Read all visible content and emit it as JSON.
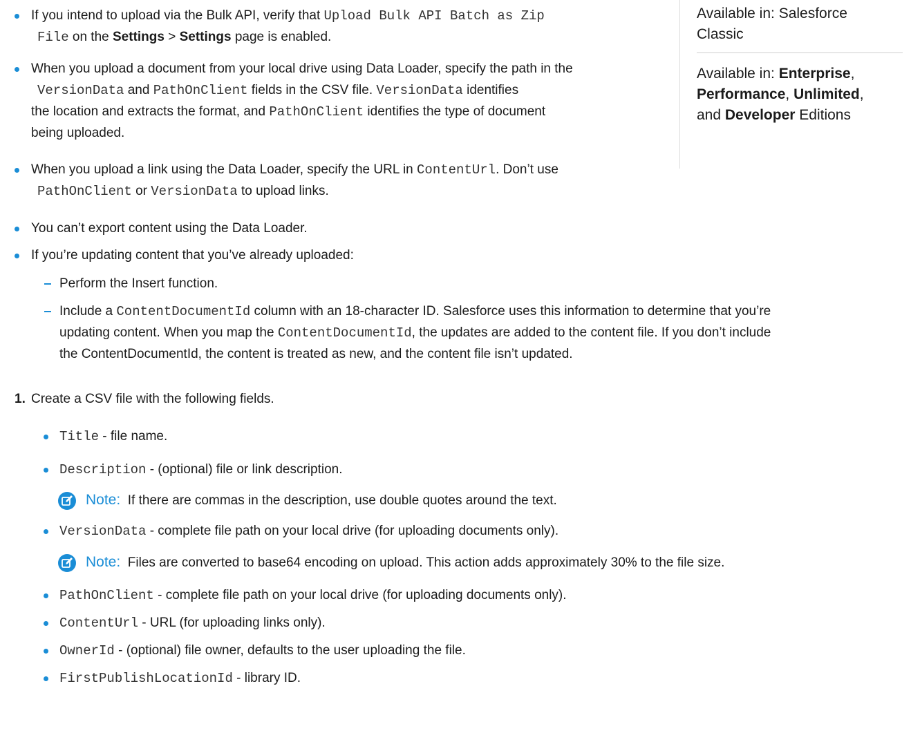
{
  "sidebar": {
    "available_1": "Available in: Salesforce",
    "available_1b": "Classic",
    "available_2_prefix": "Available in: ",
    "editions": [
      "Enterprise",
      "Performance",
      "Unlimited",
      "Developer"
    ],
    "and_text": "and ",
    "editions_suffix": " Editions"
  },
  "bullets": {
    "b1": {
      "l1_a": "If you intend to upload via the Bulk API, verify that ",
      "l1_code": "Upload Bulk API Batch as Zip",
      "l2_code": "File",
      "l2_a": " on the ",
      "settings1": "Settings",
      "gt": " > ",
      "settings2": "Settings",
      "l2_b": " page is enabled."
    },
    "b2": {
      "l1": "When you upload a document from your local drive using Data Loader, specify the path in the",
      "l2_code1": "VersionData",
      "l2_a": " and ",
      "l2_code2": "PathOnClient",
      "l2_b": " fields in the CSV file. ",
      "l2_code3": "VersionData",
      "l2_c": " identifies",
      "l3_a": "the location and extracts the format, and ",
      "l3_code": "PathOnClient",
      "l3_b": " identifies the type of document",
      "l4": "being uploaded."
    },
    "b3": {
      "l1_a": "When you upload a link using the Data Loader, specify the URL in ",
      "l1_code": "ContentUrl",
      "l1_b": ". Don’t use",
      "l2_code1": "PathOnClient",
      "l2_a": " or ",
      "l2_code2": "VersionData",
      "l2_b": " to upload links."
    },
    "b4": "You can’t export content using the Data Loader.",
    "b5": "If you’re updating content that you’ve already uploaded:"
  },
  "sub": {
    "s1": "Perform the Insert function.",
    "s2_l1_a": "Include a ",
    "s2_l1_code": "ContentDocumentId",
    "s2_l1_b": " column with an 18-character ID. Salesforce uses this information to determine that you’re",
    "s2_l2_a": "updating content. When you map the ",
    "s2_l2_code": "ContentDocumentId",
    "s2_l2_b": ", the updates are added to the content file. If you don’t include",
    "s2_l3": "the ContentDocumentId, the content is treated as new, and the content file isn’t updated."
  },
  "step1": {
    "num": "1.",
    "text": "Create a CSV file with the following fields."
  },
  "fields": [
    {
      "code": "Title",
      "desc": " - file name."
    },
    {
      "code": "Description",
      "desc": " - (optional) file or link description."
    },
    {
      "code": "VersionData",
      "desc": " - complete file path on your local drive (for uploading documents only)."
    },
    {
      "code": "PathOnClient",
      "desc": " - complete file path on your local drive (for uploading documents only)."
    },
    {
      "code": "ContentUrl",
      "desc": " - URL (for uploading links only)."
    },
    {
      "code": "OwnerId",
      "desc": " - (optional) file owner, defaults to the user uploading the file."
    },
    {
      "code": "FirstPublishLocationId",
      "desc": " - library ID."
    }
  ],
  "notes": [
    {
      "label": "Note:",
      "text": "If there are commas in the description, use double quotes around the text."
    },
    {
      "label": "Note:",
      "text": "Files are converted to base64 encoding on upload. This action adds approximately 30% to the file size."
    }
  ],
  "colors": {
    "accent": "#1a8dd6"
  },
  "icons": {
    "note": "edit-note-icon"
  }
}
